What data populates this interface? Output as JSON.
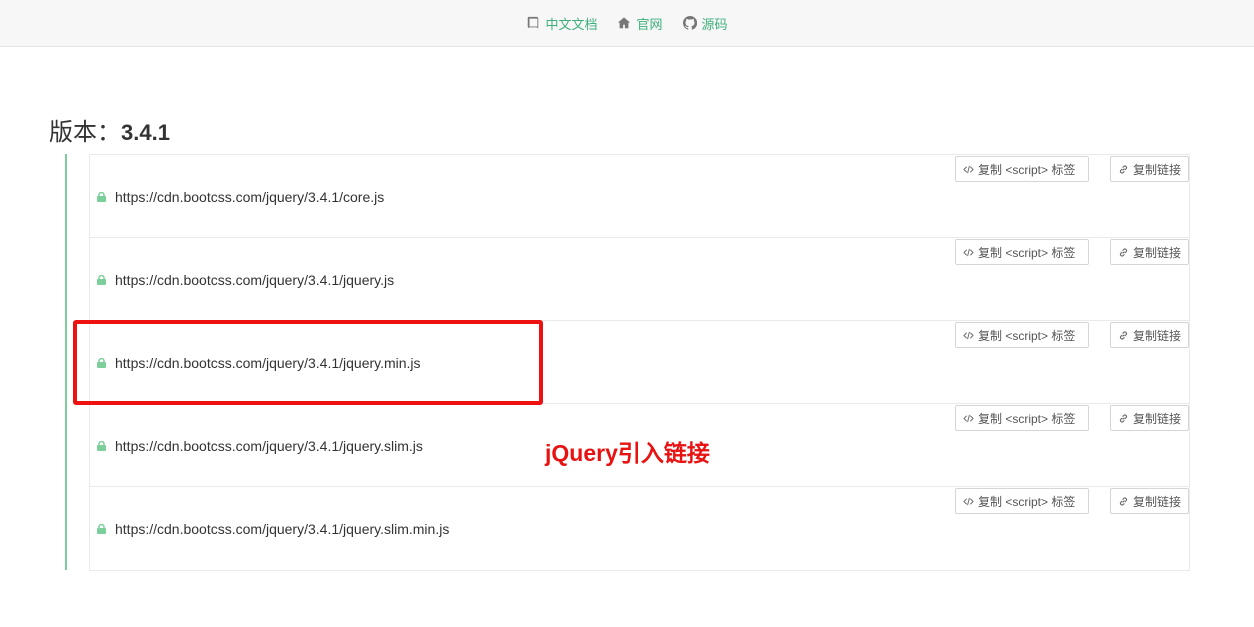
{
  "nav": {
    "items": [
      {
        "icon": "book-icon",
        "label": "中文文档"
      },
      {
        "icon": "home-icon",
        "label": "官网"
      },
      {
        "icon": "github-icon",
        "label": "源码"
      }
    ]
  },
  "heading": {
    "prefix": "版本：",
    "version": "3.4.1"
  },
  "files": [
    {
      "url": "https://cdn.bootcss.com/jquery/3.4.1/core.js",
      "copy_script_label": "复制 <script> 标签",
      "copy_link_label": "复制链接"
    },
    {
      "url": "https://cdn.bootcss.com/jquery/3.4.1/jquery.js",
      "copy_script_label": "复制 <script> 标签",
      "copy_link_label": "复制链接"
    },
    {
      "url": "https://cdn.bootcss.com/jquery/3.4.1/jquery.min.js",
      "copy_script_label": "复制 <script> 标签",
      "copy_link_label": "复制链接"
    },
    {
      "url": "https://cdn.bootcss.com/jquery/3.4.1/jquery.slim.js",
      "copy_script_label": "复制 <script> 标签",
      "copy_link_label": "复制链接"
    },
    {
      "url": "https://cdn.bootcss.com/jquery/3.4.1/jquery.slim.min.js",
      "copy_script_label": "复制 <script> 标签",
      "copy_link_label": "复制链接"
    }
  ],
  "annotation": {
    "text": "jQuery引入链接",
    "color": "#e81212"
  },
  "colors": {
    "accent": "#3eaf7c",
    "highlight": "#ee1111"
  }
}
